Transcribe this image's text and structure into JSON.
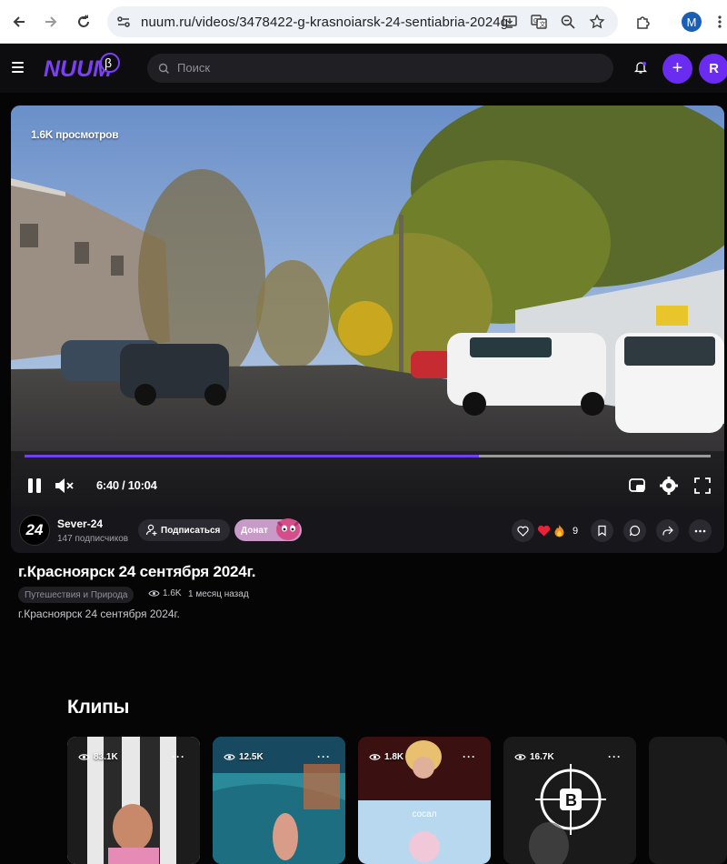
{
  "browser": {
    "url": "nuum.ru/videos/3478422-g-krasnoiarsk-24-sentiabria-2024g",
    "profile_initial": "M"
  },
  "header": {
    "logo_text": "NUUM",
    "logo_badge": "β",
    "search_placeholder": "Поиск",
    "add_label": "+",
    "user_initial": "R"
  },
  "player": {
    "views_overlay": "1.6K просмотров",
    "time": "6:40 / 10:04",
    "progress": 0.662
  },
  "channel": {
    "avatar_text": "24",
    "name": "Sever-24",
    "subscribers": "147 подписчиков",
    "subscribe_label": "Подписаться",
    "donate_label": "Донат",
    "reaction_count": "9"
  },
  "video": {
    "title": "г.Красноярск 24 сентября 2024г.",
    "category": "Путешествия и Природа",
    "views": "1.6K",
    "date": "1 месяц назад",
    "description": "г.Красноярск 24 сентября 2024г."
  },
  "clips": {
    "title": "Клипы",
    "items": [
      {
        "views": "83.1K"
      },
      {
        "views": "12.5K"
      },
      {
        "views": "1.8K",
        "caption": "сосал"
      },
      {
        "views": "16.7K"
      }
    ]
  },
  "colors": {
    "accent": "#6a2cf0",
    "background": "#050506"
  }
}
